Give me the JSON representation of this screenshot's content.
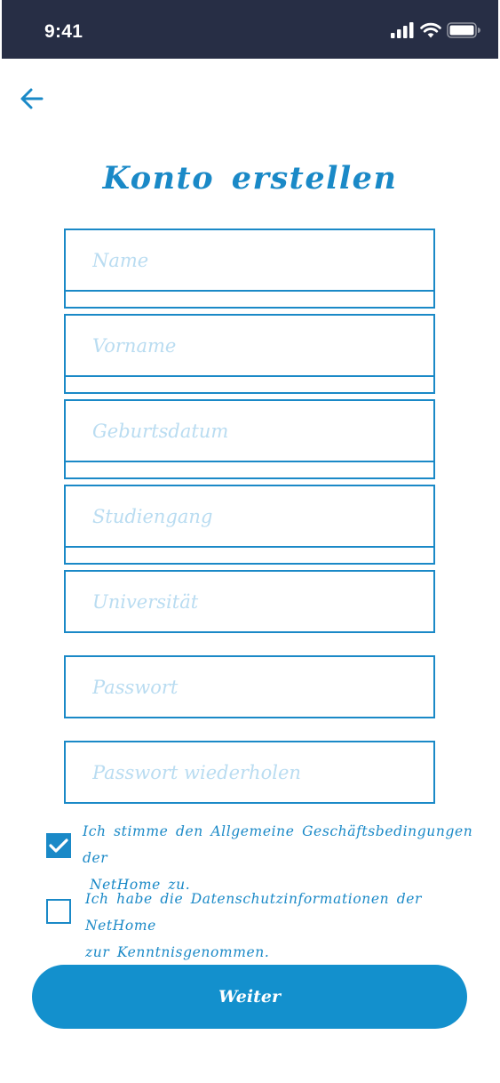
{
  "status_bar": {
    "time": "9:41",
    "icons": [
      "cellular-signal-icon",
      "wifi-icon",
      "battery-icon"
    ]
  },
  "header": {
    "back_icon": "arrow-left-icon",
    "title": "Konto erstellen"
  },
  "form": {
    "fields": [
      {
        "name": "name",
        "placeholder": "Name",
        "value": ""
      },
      {
        "name": "vorname",
        "placeholder": "Vorname",
        "value": ""
      },
      {
        "name": "geburtsdatum",
        "placeholder": "Geburtsdatum",
        "value": ""
      },
      {
        "name": "studiengang",
        "placeholder": "Studiengang",
        "value": ""
      },
      {
        "name": "universitaet",
        "placeholder": "Universität",
        "value": ""
      },
      {
        "name": "passwort",
        "placeholder": "Passwort",
        "value": ""
      },
      {
        "name": "passwort-wiederholen",
        "placeholder": "Passwort wiederholen",
        "value": ""
      }
    ]
  },
  "consents": [
    {
      "checked": true,
      "line1": "Ich stimme den Allgemeine Geschäftsbedingungen der",
      "line2": "NetHome zu."
    },
    {
      "checked": false,
      "line1": "Ich habe die Datenschutzinformationen der NetHome",
      "line2": "zur Kenntnisgenommen."
    }
  ],
  "actions": {
    "next_label": "Weiter"
  },
  "colors": {
    "accent": "#1a89c7",
    "button": "#1390cd",
    "placeholder": "#b9dcf1",
    "status_bar": "#272e45"
  }
}
